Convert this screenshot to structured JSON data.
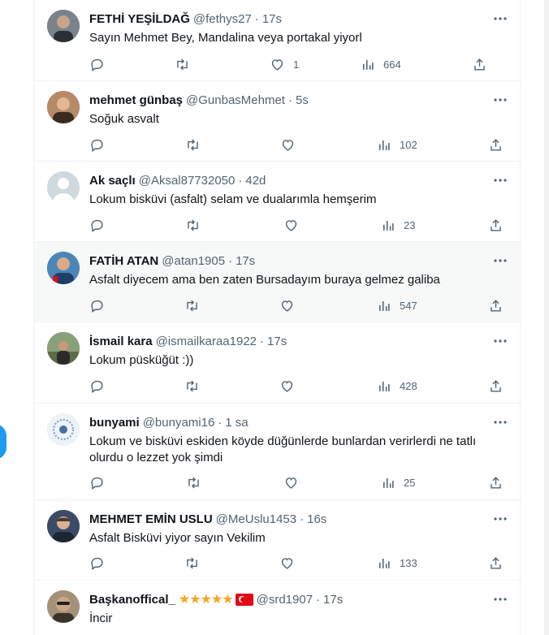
{
  "tweets": [
    {
      "name": "FETHİ YEŞİLDAĞ",
      "handle": "@fethys27",
      "time": "17s",
      "text": "Sayın Mehmet Bey,  Mandalina veya portakal yiyorl",
      "replies": "",
      "retweets": "",
      "likes": "1",
      "views": "664",
      "avatar_color": "#5a6270"
    },
    {
      "name": "mehmet günbaş",
      "handle": "@GunbasMehmet",
      "time": "5s",
      "text": "Soğuk asvalt",
      "replies": "",
      "retweets": "",
      "likes": "",
      "views": "102",
      "avatar_color": "#8a5a3c"
    },
    {
      "name": "Ak saçlı",
      "handle": "@Aksal87732050",
      "time": "42d",
      "text": "Lokum bisküvi (asfalt) selam ve dualarımla hemşerim",
      "replies": "",
      "retweets": "",
      "likes": "",
      "views": "23",
      "avatar_color": "#cfd9de"
    },
    {
      "name": "FATİH ATAN",
      "handle": "@atan1905",
      "time": "17s",
      "text": "Asfalt diyecem ama ben zaten Bursadayım buraya gelmez galiba",
      "replies": "",
      "retweets": "",
      "likes": "",
      "views": "547",
      "avatar_color": "#2d5f8a"
    },
    {
      "name": "İsmail kara",
      "handle": "@ismailkaraa1922",
      "time": "17s",
      "text": "Lokum püsküğüt :))",
      "replies": "",
      "retweets": "",
      "likes": "",
      "views": "428",
      "avatar_color": "#3f5a3a"
    },
    {
      "name": "bunyami",
      "handle": "@bunyami16",
      "time": "1 sa",
      "text": "Lokum ve bisküvi eskiden köyde düğünlerde bunlardan verirlerdi ne tatlı olurdu o lezzet yok şimdi",
      "replies": "",
      "retweets": "",
      "likes": "",
      "views": "25",
      "avatar_color": "#dbe6f3"
    },
    {
      "name": "MEHMET EMİN USLU",
      "handle": "@MeUslu1453",
      "time": "16s",
      "text": "Asfalt Bisküvi yiyor sayın Vekilim",
      "replies": "",
      "retweets": "",
      "likes": "",
      "views": "133",
      "avatar_color": "#6b4a3a"
    },
    {
      "name": "Başkanoffical_",
      "badges": "★★★★★",
      "handle": "@srd1907",
      "time": "17s",
      "text": "İncir",
      "avatar_color": "#7a6a55"
    }
  ]
}
